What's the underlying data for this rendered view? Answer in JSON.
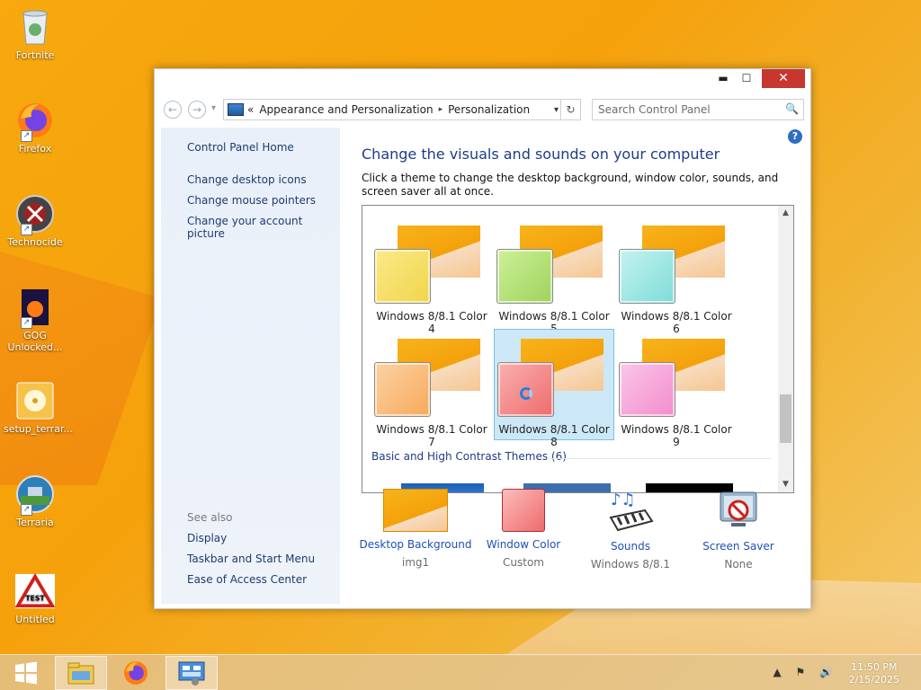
{
  "desktop": {
    "icons": [
      {
        "label": "Fortnite",
        "icon": "recycle-bin-icon"
      },
      {
        "label": "Firefox",
        "icon": "firefox-icon"
      },
      {
        "label": "Technocide",
        "icon": "technocide-icon"
      },
      {
        "label": "GOG Unlocked...",
        "icon": "gog-icon"
      },
      {
        "label": "setup_terrar...",
        "icon": "disc-icon"
      },
      {
        "label": "Terraria",
        "icon": "terraria-icon"
      },
      {
        "label": "Untitled",
        "icon": "test-sign-icon"
      }
    ]
  },
  "window": {
    "controls": {
      "minimize": "▬",
      "maximize": "☐",
      "close": "✕"
    },
    "nav": {
      "back": "←",
      "forward": "→",
      "recent": "▾"
    },
    "address": {
      "prefix": "«",
      "crumbs": [
        "Appearance and Personalization",
        "Personalization"
      ],
      "separator": "▸",
      "dropdown": "▾",
      "refresh": "↻"
    },
    "search": {
      "placeholder": "Search Control Panel",
      "icon": "🔍"
    }
  },
  "sidebar": {
    "home": "Control Panel Home",
    "links": [
      "Change desktop icons",
      "Change mouse pointers",
      "Change your account picture"
    ],
    "see_also_title": "See also",
    "see_also": [
      "Display",
      "Taskbar and Start Menu",
      "Ease of Access Center"
    ]
  },
  "main": {
    "help": "?",
    "heading": "Change the visuals and sounds on your computer",
    "description": "Click a theme to change the desktop background, window color, sounds, and screen saver all at once.",
    "themes": [
      {
        "label": "Windows 8/8.1 Color 4",
        "color": "#f0d54a",
        "selected": false
      },
      {
        "label": "Windows 8/8.1 Color 5",
        "color": "#9fd35a",
        "selected": false
      },
      {
        "label": "Windows 8/8.1 Color 6",
        "color": "#7fdcd8",
        "selected": false
      },
      {
        "label": "Windows 8/8.1 Color 7",
        "color": "#f6a95a",
        "selected": false
      },
      {
        "label": "Windows 8/8.1 Color 8",
        "color": "#ef6b6b",
        "selected": true
      },
      {
        "label": "Windows 8/8.1 Color 9",
        "color": "#f38ccd",
        "selected": false
      }
    ],
    "group_header": "Basic and High Contrast Themes (6)",
    "scroll": {
      "up": "▲",
      "down": "▼"
    },
    "bottom": [
      {
        "label": "Desktop Background",
        "value": "img1"
      },
      {
        "label": "Window Color",
        "value": "Custom"
      },
      {
        "label": "Sounds",
        "value": "Windows 8/8.1"
      },
      {
        "label": "Screen Saver",
        "value": "None"
      }
    ]
  },
  "taskbar": {
    "items": [
      "start-button",
      "file-explorer",
      "firefox",
      "control-panel"
    ],
    "tray": "▲ ⚑ 🔊",
    "time": "11:50 PM",
    "date": "2/15/2025"
  }
}
